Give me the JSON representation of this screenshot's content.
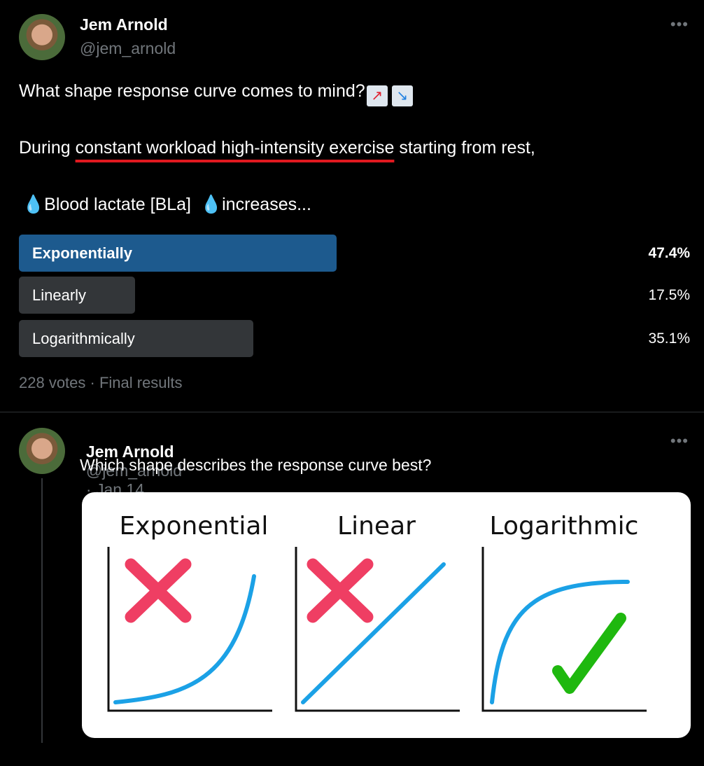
{
  "tweet": {
    "author_name": "Jem Arnold",
    "author_handle": "@jem_arnold",
    "line1": "What shape response curve comes to mind?",
    "line1_emojis": [
      "chart-increasing-icon",
      "chart-decreasing-icon"
    ],
    "line2_prefix": "During ",
    "line2_underlined": "constant workload high-intensity exercise",
    "line2_suffix": " starting from rest,",
    "line3": "Blood lactate [BLa]",
    "line3_suffix": "increases...",
    "underline_color": "#e0191f",
    "poll": {
      "options": [
        {
          "label": "Exponentially",
          "percent": "47.4%",
          "value": 47.4,
          "winner": true
        },
        {
          "label": "Linearly",
          "percent": "17.5%",
          "value": 17.5,
          "winner": false
        },
        {
          "label": "Logarithmically",
          "percent": "35.1%",
          "value": 35.1,
          "winner": false
        }
      ],
      "footer": "228 votes · Final results",
      "winner_color": "#1d5a8e"
    }
  },
  "reply": {
    "author_name": "Jem Arnold",
    "author_handle": "@jem_arnold",
    "date": "· Jan 14",
    "text": "Which shape describes the response curve best?",
    "image": {
      "panels": [
        {
          "title": "Exponential",
          "mark": "cross"
        },
        {
          "title": "Linear",
          "mark": "cross"
        },
        {
          "title": "Logarithmic",
          "mark": "check"
        }
      ],
      "curve_color": "#1ba1e6",
      "cross_color": "#ef3e63",
      "check_color": "#1fb80f"
    }
  }
}
